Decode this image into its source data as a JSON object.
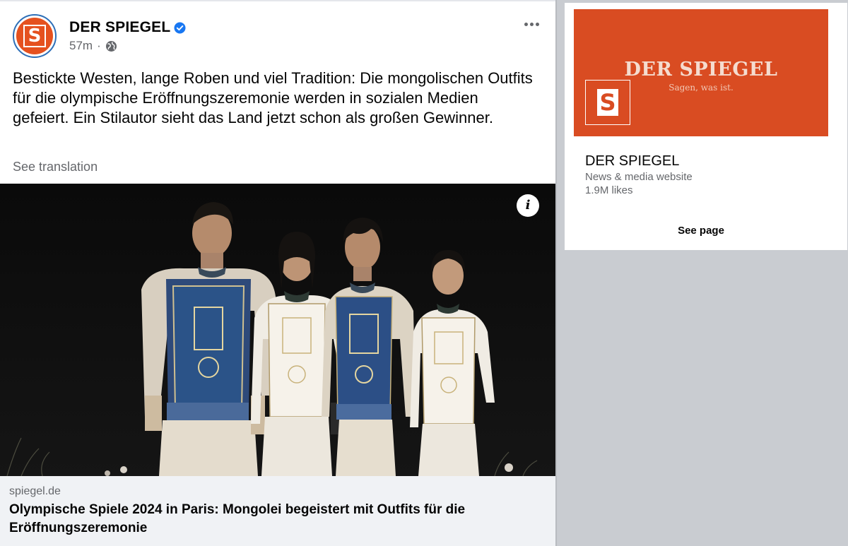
{
  "post": {
    "page_name": "DER SPIEGEL",
    "avatar_letter": "S",
    "time": "57m",
    "separator": "·",
    "verified_icon": "verified-badge-icon",
    "audience_icon": "globe-icon",
    "more_icon": "more-options-icon",
    "text": "Bestickte Westen, lange Roben und viel Tradition: Die mongolischen Outfits für die olympische Eröffnungszeremonie werden in sozialen Medien gefeiert. Ein Stilautor sieht das Land jetzt schon als großen Gewinner.",
    "see_translation": "See translation",
    "info_icon": "info-icon",
    "info_letter": "i",
    "link": {
      "domain": "spiegel.de",
      "title": "Olympische Spiele 2024 in Paris: Mongolei begeistert mit Outfits für die Eröffnungszeremonie"
    }
  },
  "side_panel": {
    "cover": {
      "wordmark": "DER SPIEGEL",
      "tagline": "Sagen, was ist.",
      "logo_letter": "S"
    },
    "page_name": "DER SPIEGEL",
    "category": "News & media website",
    "likes": "1.9M likes",
    "see_page": "See page"
  },
  "colors": {
    "brand_orange": "#e5511f",
    "verified_blue": "#1877f2",
    "secondary_text": "#65676b",
    "background_gray": "#c9ccd1"
  }
}
